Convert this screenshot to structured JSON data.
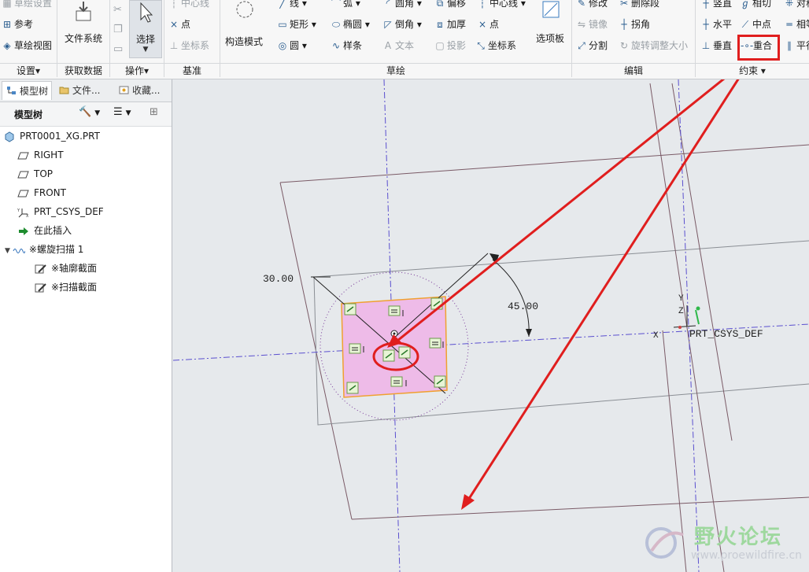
{
  "ribbon": {
    "settings_group": {
      "items": [
        "草绘设置",
        "参考",
        "草绘视图"
      ],
      "label": "设置▾"
    },
    "get_data_group": {
      "file_system": "文件系统",
      "label": "获取数据"
    },
    "ops_group": {
      "select": "选择",
      "label": "操作▾"
    },
    "datum_group": {
      "items": [
        "中心线",
        "点",
        "坐标系"
      ],
      "label": "基准"
    },
    "sketch_group": {
      "construct_mode": "构造模式",
      "row1": [
        "线 ▾",
        "弧 ▾",
        "圆角 ▾",
        "偏移",
        "中心线 ▾"
      ],
      "row2": [
        "矩形 ▾",
        "椭圆 ▾",
        "倒角 ▾",
        "加厚",
        "点"
      ],
      "row3": [
        "圆 ▾",
        "样条",
        "文本",
        "投影",
        "坐标系"
      ],
      "palette": "选项板",
      "label": "草绘"
    },
    "edit_group": {
      "row1": [
        "修改",
        "删除段"
      ],
      "row2": [
        "镜像",
        "拐角"
      ],
      "row3": [
        "分割",
        "旋转调整大小"
      ],
      "label": "编辑"
    },
    "constraint_group": {
      "row1": [
        "竖直",
        "相切",
        "对称"
      ],
      "row2": [
        "水平",
        "中点",
        "相等"
      ],
      "row3": [
        "垂直",
        "重合",
        "平行"
      ],
      "label": "约束 ▾"
    }
  },
  "panel": {
    "tabs": [
      "模型树",
      "文件...",
      "收藏..."
    ],
    "header": "模型树",
    "tree": [
      {
        "label": "PRT0001_XG.PRT",
        "icon": "part-icon"
      },
      {
        "label": "RIGHT",
        "icon": "datum-plane-icon"
      },
      {
        "label": "TOP",
        "icon": "datum-plane-icon"
      },
      {
        "label": "FRONT",
        "icon": "datum-plane-icon"
      },
      {
        "label": "PRT_CSYS_DEF",
        "icon": "csys-icon"
      },
      {
        "label": "在此插入",
        "icon": "insert-arrow-icon"
      },
      {
        "label": "※螺旋扫描 1",
        "icon": "helical-sweep-icon"
      },
      {
        "label": "※轴廓截面",
        "icon": "sketch-icon"
      },
      {
        "label": "※扫描截面",
        "icon": "sketch-icon"
      }
    ]
  },
  "canvas": {
    "dim_length": "30.00",
    "dim_angle": "45.00",
    "csys_label": "PRT_CSYS_DEF",
    "axis_x": "X",
    "axis_y": "Y",
    "axis_z": "Z"
  },
  "watermark": {
    "title": "野火论坛",
    "url": "www.proewildfire.cn"
  },
  "colors": {
    "highlight": "#e01e1e",
    "sketch_fill": "#eebbe8",
    "sketch_edge": "#f0a030",
    "datum_axis": "#5a4fcf"
  }
}
